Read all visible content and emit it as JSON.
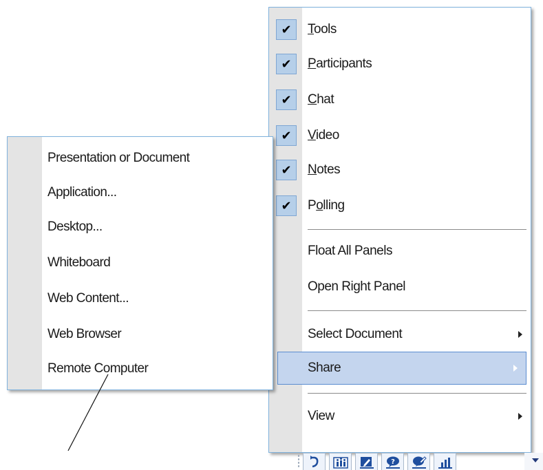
{
  "main_menu": {
    "items": [
      {
        "pre": "",
        "key": "T",
        "post": "ools",
        "checked": true
      },
      {
        "pre": "",
        "key": "P",
        "post": "articipants",
        "checked": true
      },
      {
        "pre": "",
        "key": "C",
        "post": "hat",
        "checked": true
      },
      {
        "pre": "",
        "key": "V",
        "post": "ideo",
        "checked": true
      },
      {
        "pre": "",
        "key": "N",
        "post": "otes",
        "checked": true
      },
      {
        "pre": "P",
        "key": "o",
        "post": "lling",
        "checked": true
      }
    ],
    "check_mark": "✔",
    "float_all_panels": "Float All Panels",
    "open_right_panel": "Open Right Panel",
    "select_document": "Select Document",
    "share": "Share",
    "view": "View"
  },
  "share_submenu": {
    "items": [
      "Presentation or Document",
      "Application...",
      "Desktop...",
      "Whiteboard",
      "Web Content...",
      "Web Browser",
      "Remote Computer"
    ]
  },
  "toolbar": {
    "icons": [
      "refresh-icon",
      "attendees-icon",
      "document-edit-icon",
      "q-and-a-icon",
      "annotate-icon",
      "poll-results-icon"
    ],
    "icon_color": "#1f4e9e"
  },
  "colors": {
    "menu_border": "#7fb2dd",
    "gutter": "#e4e4e4",
    "highlight": "#c4d5ee",
    "checkbox": "#b6cfe9"
  }
}
